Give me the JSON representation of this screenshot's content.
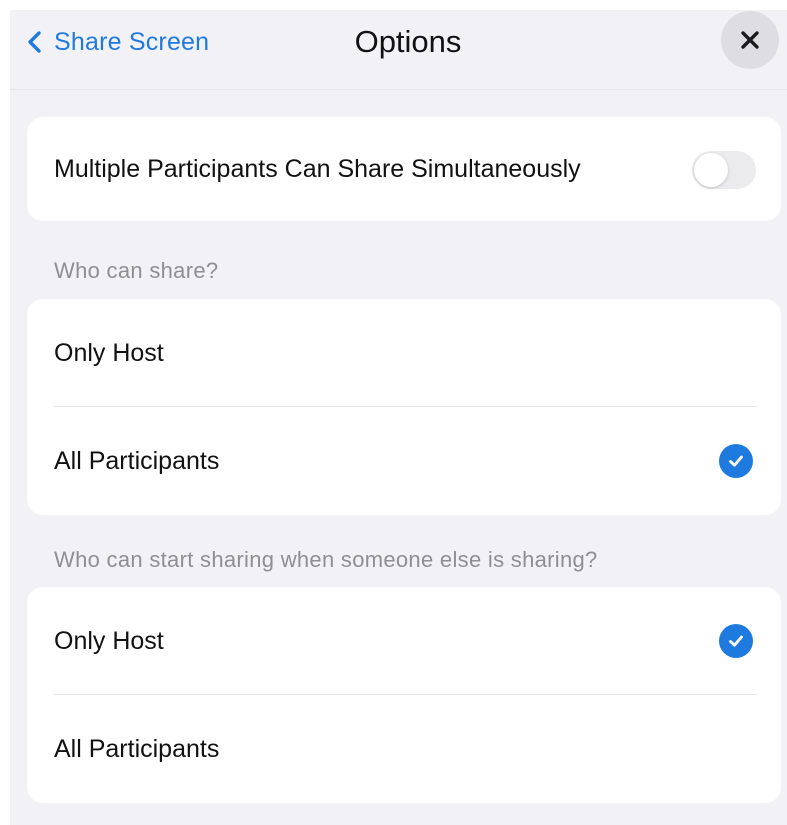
{
  "header": {
    "back_label": "Share Screen",
    "title": "Options"
  },
  "colors": {
    "accent": "#1f7ae0",
    "background": "#f2f2f6",
    "card": "#ffffff",
    "section_label": "#8e8e93"
  },
  "simultaneous": {
    "label": "Multiple Participants Can Share Simultaneously",
    "enabled": false
  },
  "who_can_share": {
    "heading": "Who can share?",
    "options": [
      {
        "label": "Only Host",
        "selected": false
      },
      {
        "label": "All Participants",
        "selected": true
      }
    ]
  },
  "who_can_start": {
    "heading": "Who can start sharing when someone else is sharing?",
    "options": [
      {
        "label": "Only Host",
        "selected": true
      },
      {
        "label": "All Participants",
        "selected": false
      }
    ]
  },
  "icons": {
    "back": "chevron-left-icon",
    "close": "close-icon",
    "selected": "checkmark-icon"
  }
}
